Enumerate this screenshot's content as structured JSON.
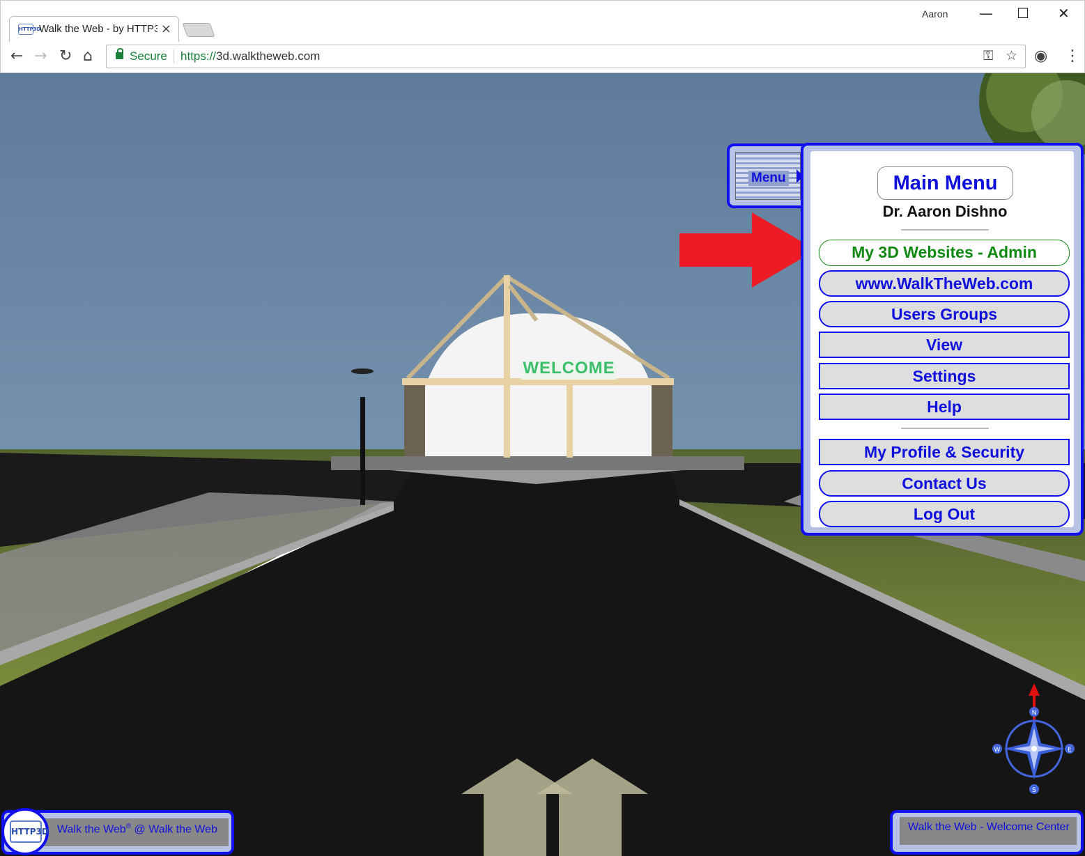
{
  "browser": {
    "tab_title": "Walk the Web - by HTTP3D",
    "tab_favicon": "HTTP3D",
    "tab_close": "×",
    "profile_name": "Aaron",
    "minimize": "—",
    "maximize": "☐",
    "close": "✕",
    "back": "←",
    "forward": "→",
    "reload": "↻",
    "home": "⌂",
    "secure_label": "Secure",
    "url_scheme": "https://",
    "url_host": "3d.walktheweb.com",
    "key_icon": "⚿",
    "star_icon": "☆",
    "extension_icon": "◉",
    "kebab_icon": "⋮"
  },
  "scene": {
    "sign_text": "WELCOME"
  },
  "menu_tab": {
    "label": "Menu"
  },
  "main_menu": {
    "title": "Main Menu",
    "user_name": "Dr. Aaron Dishno",
    "items": [
      {
        "label": "My 3D Websites - Admin"
      },
      {
        "label": "www.WalkTheWeb.com"
      },
      {
        "label": "Users Groups"
      },
      {
        "label": "View"
      },
      {
        "label": "Settings"
      },
      {
        "label": "Help"
      },
      {
        "label": "My Profile & Security"
      },
      {
        "label": "Contact Us"
      },
      {
        "label": "Log Out"
      }
    ]
  },
  "bottom_left": {
    "logo": "HTTP3D",
    "brand": "Walk the Web",
    "reg": "®",
    "suffix": " @ Walk the Web"
  },
  "bottom_right": {
    "location": "Walk the Web - Welcome Center"
  },
  "compass": {
    "n": "N",
    "e": "E",
    "s": "S",
    "w": "W"
  },
  "colors": {
    "accent_blue": "#1010ee",
    "admin_green": "#118811",
    "annotation_red": "#ed1c24",
    "sky": "#6a85a4"
  }
}
